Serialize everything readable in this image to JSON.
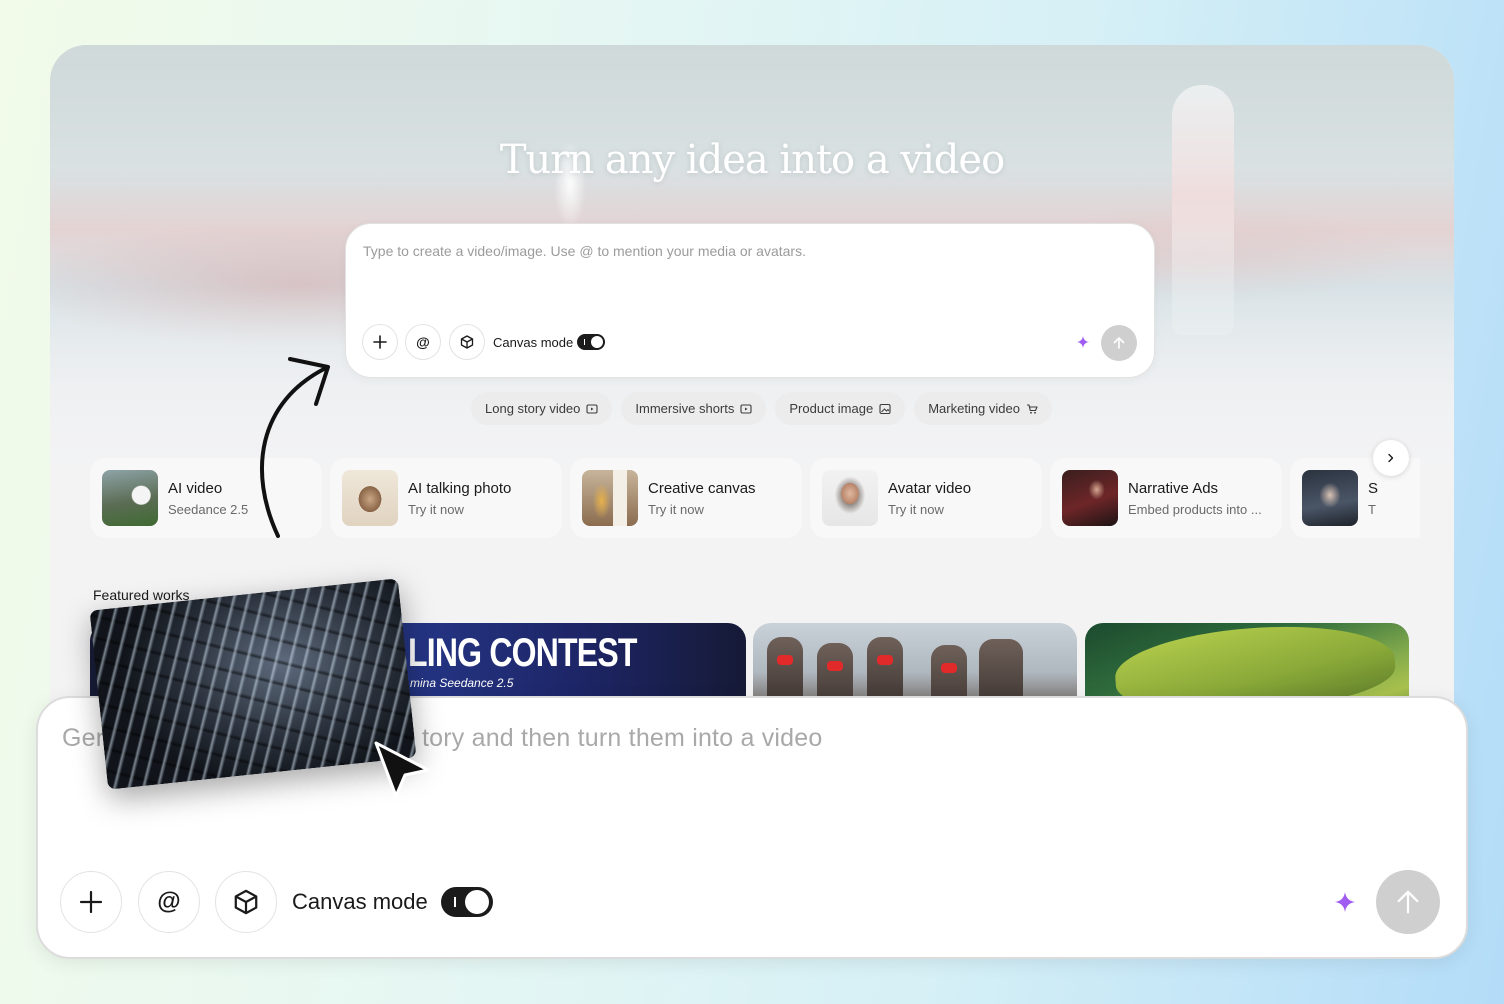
{
  "hero": {
    "title": "Turn any idea into a video"
  },
  "prompt": {
    "placeholder": "Type to create a video/image. Use @ to mention your media or avatars.",
    "canvas_mode_label": "Canvas mode",
    "canvas_mode_on": true
  },
  "chips": [
    {
      "label": "Long story video",
      "icon": "video-icon"
    },
    {
      "label": "Immersive shorts",
      "icon": "video-icon"
    },
    {
      "label": "Product image",
      "icon": "image-icon"
    },
    {
      "label": "Marketing video",
      "icon": "cart-icon"
    }
  ],
  "features": [
    {
      "title": "AI video",
      "subtitle": "Seedance 2.5"
    },
    {
      "title": "AI talking photo",
      "subtitle": "Try it now"
    },
    {
      "title": "Creative canvas",
      "subtitle": "Try it now"
    },
    {
      "title": "Avatar video",
      "subtitle": "Try it now"
    },
    {
      "title": "Narrative Ads",
      "subtitle": "Embed products into ..."
    },
    {
      "title": "S",
      "subtitle": "T"
    }
  ],
  "featured": {
    "label": "Featured works",
    "contest_title": "LING CONTEST",
    "contest_subtitle": "mina Seedance 2.5"
  },
  "zoom": {
    "placeholder_left": "Gene",
    "placeholder_right": "tory and then turn them into a video",
    "canvas_mode_label": "Canvas mode"
  },
  "colors": {
    "accent": "#a05cf0",
    "toggle": "#1b1b1b",
    "send_disabled": "#cfcfcf"
  }
}
